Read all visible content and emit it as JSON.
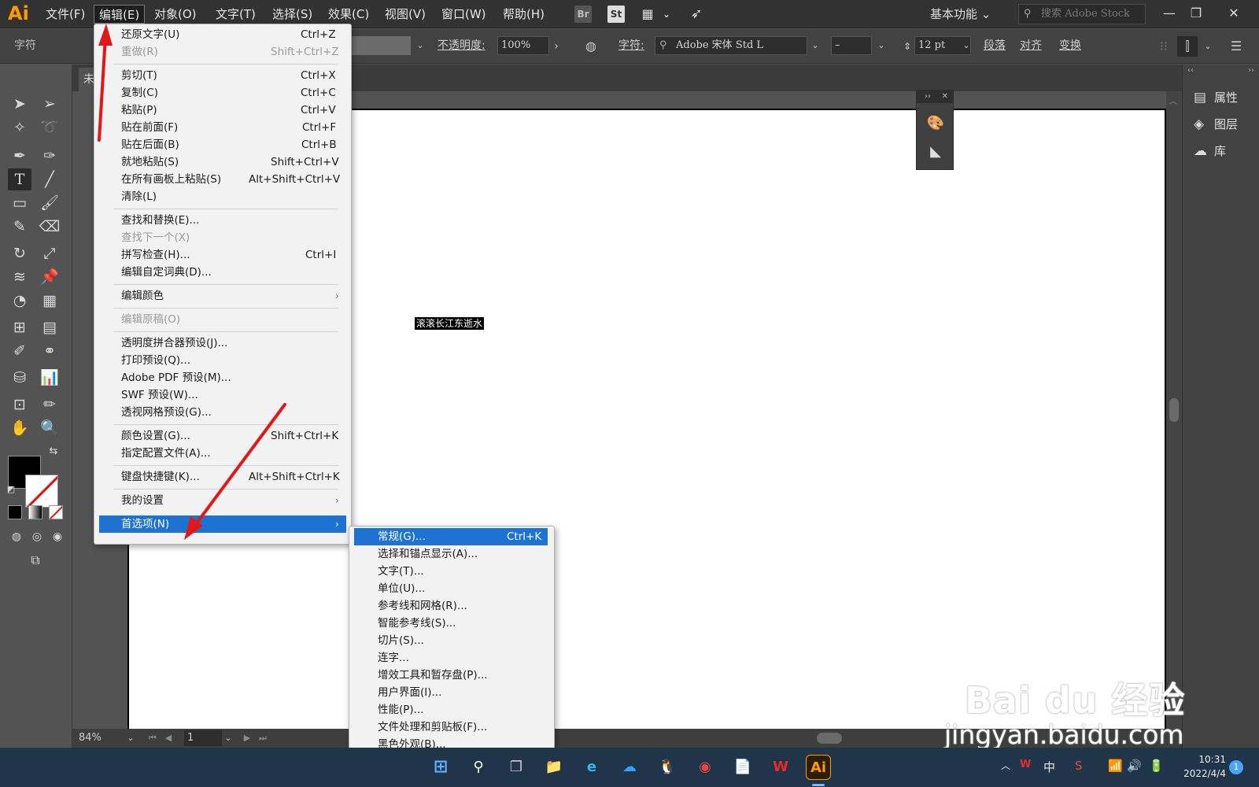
{
  "menubar": {
    "logo": "Ai",
    "items": [
      "文件(F)",
      "编辑(E)",
      "对象(O)",
      "文字(T)",
      "选择(S)",
      "效果(C)",
      "视图(V)",
      "窗口(W)",
      "帮助(H)"
    ],
    "bridge_label": "Br",
    "stock_label": "St",
    "workspace": "基本功能",
    "search_placeholder": "搜索 Adobe Stock"
  },
  "controlbar": {
    "panel_label": "字符",
    "opacity_label": "不透明度",
    "opacity_value": "100%",
    "char_label": "字符",
    "font_name": "Adobe 宋体 Std L",
    "font_style": "–",
    "font_size": "12 pt",
    "paragraph_label": "段落",
    "align_label": "对齐",
    "transform_label": "变换"
  },
  "document": {
    "tab_label": "未",
    "selected_text": "滚滚长江东逝水"
  },
  "statusbar": {
    "zoom": "84%",
    "page": "1"
  },
  "right_panel": {
    "items": [
      "属性",
      "图层",
      "库"
    ]
  },
  "edit_menu": {
    "items": [
      {
        "label": "还原文字(U)",
        "shortcut": "Ctrl+Z"
      },
      {
        "label": "重做(R)",
        "shortcut": "Shift+Ctrl+Z",
        "disabled": true
      },
      {
        "label": "剪切(T)",
        "shortcut": "Ctrl+X"
      },
      {
        "label": "复制(C)",
        "shortcut": "Ctrl+C"
      },
      {
        "label": "粘贴(P)",
        "shortcut": "Ctrl+V"
      },
      {
        "label": "贴在前面(F)",
        "shortcut": "Ctrl+F"
      },
      {
        "label": "贴在后面(B)",
        "shortcut": "Ctrl+B"
      },
      {
        "label": "就地粘贴(S)",
        "shortcut": "Shift+Ctrl+V"
      },
      {
        "label": "在所有画板上粘贴(S)",
        "shortcut": "Alt+Shift+Ctrl+V"
      },
      {
        "label": "清除(L)",
        "shortcut": ""
      },
      {
        "label": "查找和替换(E)...",
        "shortcut": ""
      },
      {
        "label": "查找下一个(X)",
        "shortcut": "",
        "disabled": true
      },
      {
        "label": "拼写检查(H)...",
        "shortcut": "Ctrl+I"
      },
      {
        "label": "编辑自定词典(D)...",
        "shortcut": ""
      },
      {
        "label": "编辑颜色",
        "shortcut": "",
        "submenu": true
      },
      {
        "label": "编辑原稿(O)",
        "shortcut": "",
        "disabled": true
      },
      {
        "label": "透明度拼合器预设(J)...",
        "shortcut": ""
      },
      {
        "label": "打印预设(Q)...",
        "shortcut": ""
      },
      {
        "label": "Adobe PDF 预设(M)...",
        "shortcut": ""
      },
      {
        "label": "SWF 预设(W)...",
        "shortcut": ""
      },
      {
        "label": "透视网格预设(G)...",
        "shortcut": ""
      },
      {
        "label": "颜色设置(G)...",
        "shortcut": "Shift+Ctrl+K"
      },
      {
        "label": "指定配置文件(A)...",
        "shortcut": ""
      },
      {
        "label": "键盘快捷键(K)...",
        "shortcut": "Alt+Shift+Ctrl+K"
      },
      {
        "label": "我的设置",
        "shortcut": "",
        "submenu": true
      },
      {
        "label": "首选项(N)",
        "shortcut": "",
        "submenu": true,
        "highlighted": true
      }
    ]
  },
  "prefs_submenu": {
    "items": [
      {
        "label": "常规(G)...",
        "shortcut": "Ctrl+K",
        "highlighted": true
      },
      {
        "label": "选择和锚点显示(A)...",
        "shortcut": ""
      },
      {
        "label": "文字(T)...",
        "shortcut": ""
      },
      {
        "label": "单位(U)...",
        "shortcut": ""
      },
      {
        "label": "参考线和网格(R)...",
        "shortcut": ""
      },
      {
        "label": "智能参考线(S)...",
        "shortcut": ""
      },
      {
        "label": "切片(S)...",
        "shortcut": ""
      },
      {
        "label": "连字...",
        "shortcut": ""
      },
      {
        "label": "增效工具和暂存盘(P)...",
        "shortcut": ""
      },
      {
        "label": "用户界面(I)...",
        "shortcut": ""
      },
      {
        "label": "性能(P)...",
        "shortcut": ""
      },
      {
        "label": "文件处理和剪贴板(F)...",
        "shortcut": ""
      },
      {
        "label": "黑色外观(B)...",
        "shortcut": ""
      }
    ]
  },
  "watermark": {
    "brand": "Bai du 经验",
    "url": "jingyan.baidu.com"
  },
  "taskbar": {
    "ime": "中",
    "time": "10:31",
    "date": "2022/4/4",
    "notifications": "1",
    "ai_label": "Ai"
  },
  "colors": {
    "menu_highlight": "#1e73d2",
    "annotation_arrow": "#e01818",
    "ai_orange": "#ff9a00"
  }
}
